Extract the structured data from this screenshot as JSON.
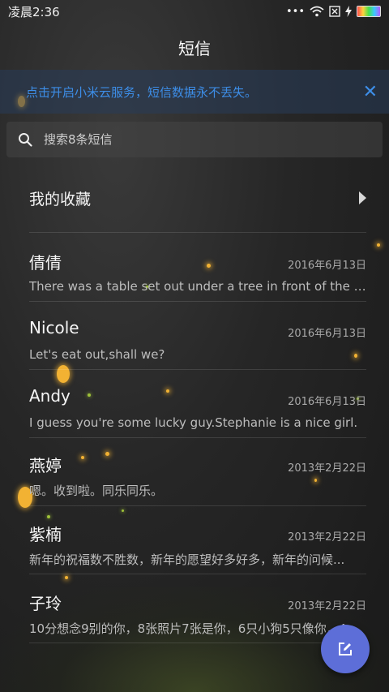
{
  "status_bar": {
    "time": "凌晨2:36",
    "more": "•••"
  },
  "header": {
    "title": "短信"
  },
  "banner": {
    "text": "点击开启小米云服务，短信数据永不丢失。",
    "close": "✕"
  },
  "search": {
    "placeholder": "搜索8条短信"
  },
  "favorites": {
    "label": "我的收藏"
  },
  "conversations": [
    {
      "name": "倩倩",
      "date": "2016年6月13日",
      "preview": "There was a table set out under a tree in front of the ho..."
    },
    {
      "name": "Nicole",
      "date": "2016年6月13日",
      "preview": "Let's eat out,shall we?"
    },
    {
      "name": "Andy",
      "date": "2016年6月13日",
      "preview": "I guess you're some lucky guy.Stephanie is a nice girl."
    },
    {
      "name": "燕婷",
      "date": "2013年2月22日",
      "preview": "嗯。收到啦。同乐同乐。"
    },
    {
      "name": "紫楠",
      "date": "2013年2月22日",
      "preview": "新年的祝福数不胜数，新年的愿望好多好多，新年的问候..."
    },
    {
      "name": "子玲",
      "date": "2013年2月22日",
      "preview": "10分想念9别的你，8张照片7张是你，6只小狗5只像你，4..."
    }
  ],
  "fab": {
    "icon": "compose-icon"
  },
  "colors": {
    "accent": "#3d8ee8",
    "fab": "#5d6ed8",
    "banner_bg": "#283c5a"
  }
}
